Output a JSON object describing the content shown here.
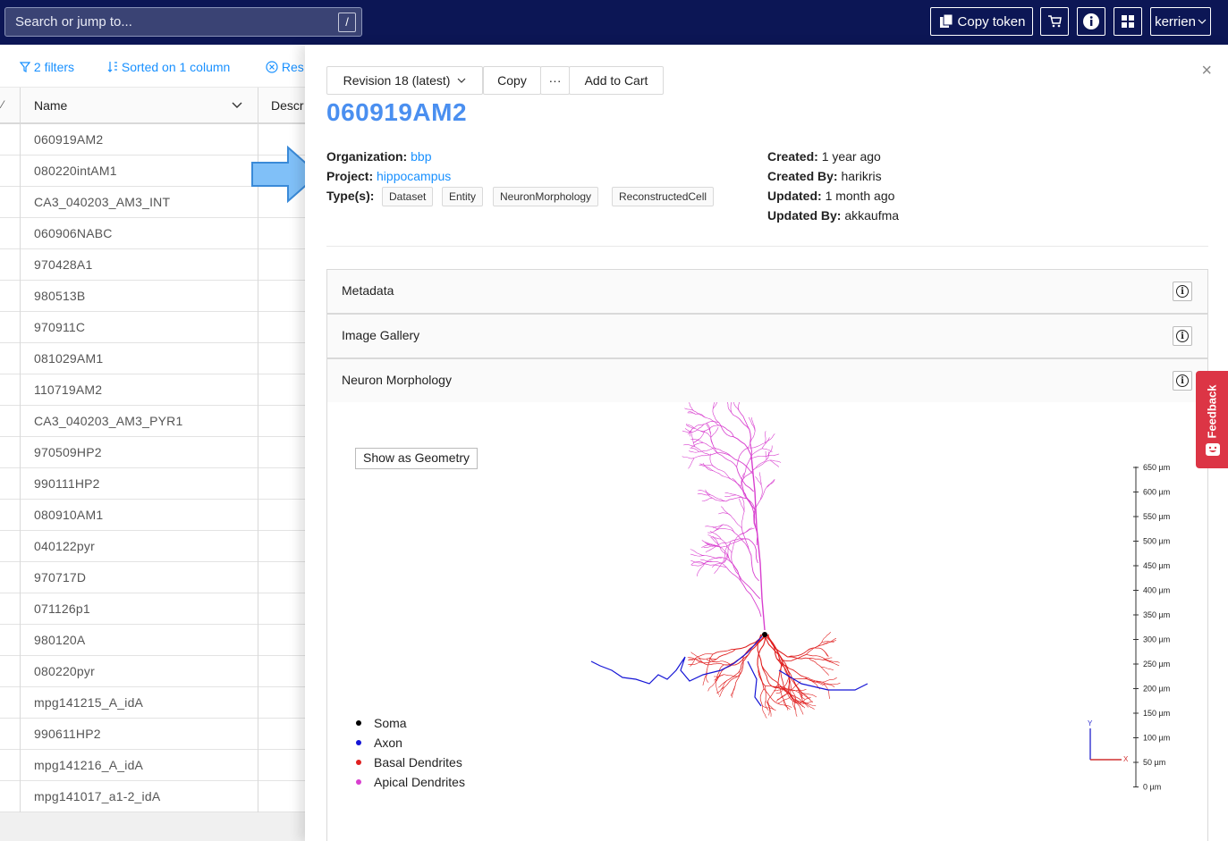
{
  "topbar": {
    "search_placeholder": "Search or jump to...",
    "search_shortcut": "/",
    "copy_token": "Copy token",
    "user": "kerrien"
  },
  "table": {
    "filters_label": "2 filters",
    "sorted_label": "Sorted on 1 column",
    "reset_label": "Res",
    "col_name": "Name",
    "col_desc": "Descr",
    "rows": [
      "060919AM2",
      "080220intAM1",
      "CA3_040203_AM3_INT",
      "060906NABC",
      "970428A1",
      "980513B",
      "970911C",
      "081029AM1",
      "110719AM2",
      "CA3_040203_AM3_PYR1",
      "970509HP2",
      "990111HP2",
      "080910AM1",
      "040122pyr",
      "970717D",
      "071126p1",
      "980120A",
      "080220pyr",
      "mpg141215_A_idA",
      "990611HP2",
      "mpg141216_A_idA",
      "mpg141017_a1-2_idA"
    ]
  },
  "drawer": {
    "revision": "Revision 18 (latest)",
    "copy": "Copy",
    "more": "···",
    "add_to_cart": "Add to Cart",
    "close": "×",
    "title": "060919AM2",
    "org_label": "Organization:",
    "org_value": "bbp",
    "project_label": "Project:",
    "project_value": "hippocampus",
    "types_label": "Type(s):",
    "types": [
      "Dataset",
      "Entity",
      "NeuronMorphology",
      "ReconstructedCell"
    ],
    "created_label": "Created:",
    "created_value": "1 year ago",
    "created_by_label": "Created By:",
    "created_by_value": "harikris",
    "updated_label": "Updated:",
    "updated_value": "1 month ago",
    "updated_by_label": "Updated By:",
    "updated_by_value": "akkaufma",
    "panels": [
      "Metadata",
      "Image Gallery",
      "Neuron Morphology"
    ]
  },
  "viewer": {
    "show_geometry": "Show as Geometry",
    "legend": [
      {
        "label": "Soma",
        "color": "#000000"
      },
      {
        "label": "Axon",
        "color": "#1515d6"
      },
      {
        "label": "Basal Dendrites",
        "color": "#e02020"
      },
      {
        "label": "Apical Dendrites",
        "color": "#d83fcf"
      }
    ],
    "scale_ticks": [
      "650 µm",
      "600 µm",
      "550 µm",
      "500 µm",
      "450 µm",
      "400 µm",
      "350 µm",
      "300 µm",
      "250 µm",
      "200 µm",
      "150 µm",
      "100 µm",
      "50 µm",
      "0 µm"
    ],
    "axis_y": "Y",
    "axis_x": "X"
  },
  "feedback": "Feedback",
  "colors": {
    "nav": "#0c1655",
    "link": "#1890ff",
    "title": "#4a8ff0",
    "feedback": "#dc3545"
  }
}
